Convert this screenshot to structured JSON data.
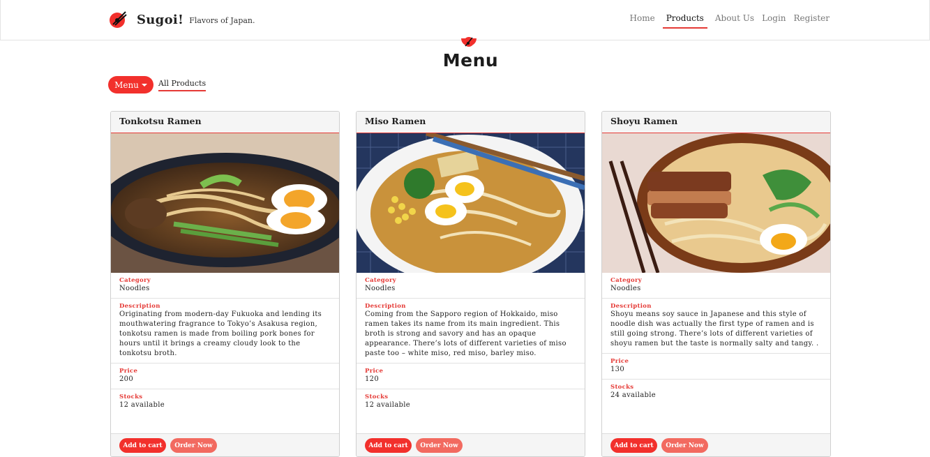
{
  "brand": {
    "name": "Sugoi!",
    "tagline": "Flavors of Japan."
  },
  "nav": {
    "items": [
      {
        "label": "Home"
      },
      {
        "label": "Products"
      },
      {
        "label": "About Us"
      },
      {
        "label": "Login"
      },
      {
        "label": "Register"
      }
    ],
    "active": "Products"
  },
  "page": {
    "title": "Menu"
  },
  "controls": {
    "menu_button": "Menu",
    "filter_link": "All Products"
  },
  "labels": {
    "category": "Category",
    "description": "Description",
    "price": "Price",
    "stocks": "Stocks"
  },
  "buttons": {
    "add_to_cart": "Add to cart",
    "order_now": "Order Now"
  },
  "products": [
    {
      "name": "Tonkotsu Ramen",
      "category": "Noodles",
      "description": "Originating from modern-day Fukuoka and lending its mouthwatering fragrance to Tokyo’s Asakusa region, tonkotsu ramen is made from boiling pork bones for hours until it brings a creamy cloudy look to the tonkotsu broth.",
      "price": "200",
      "stocks": "12 available"
    },
    {
      "name": "Miso Ramen",
      "category": "Noodles",
      "description": "Coming from the Sapporo region of Hokkaido, miso ramen takes its name from its main ingredient. This broth is strong and savory and has an opaque appearance. There’s lots of different varieties of miso paste too – white miso, red miso, barley miso.",
      "price": "120",
      "stocks": "12 available"
    },
    {
      "name": "Shoyu Ramen",
      "category": "Noodles",
      "description": "Shoyu means soy sauce in Japanese and this style of noodle dish was actually the first type of ramen and is still going strong. There’s lots of different varieties of shoyu ramen but the taste is normally salty and tangy. .",
      "price": "130",
      "stocks": "24 available"
    }
  ],
  "colors": {
    "accent": "#e53935",
    "button_primary": "#f2302c",
    "button_secondary": "#f26a60"
  }
}
